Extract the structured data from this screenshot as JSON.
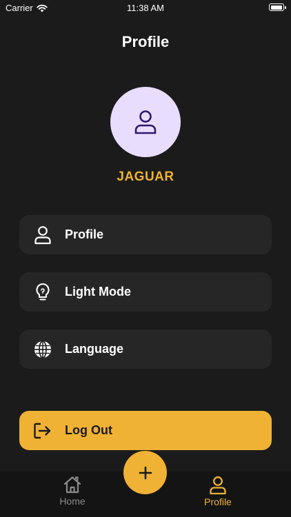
{
  "status_bar": {
    "carrier": "Carrier",
    "time": "11:38 AM"
  },
  "header": {
    "title": "Profile"
  },
  "user": {
    "name": "JAGUAR"
  },
  "menu": {
    "items": [
      {
        "label": "Profile",
        "icon": "person-icon"
      },
      {
        "label": "Light Mode",
        "icon": "lightbulb-icon"
      },
      {
        "label": "Language",
        "icon": "globe-icon"
      }
    ],
    "logout": {
      "label": "Log Out",
      "icon": "logout-icon"
    }
  },
  "bottom_nav": {
    "items": [
      {
        "label": "Home",
        "icon": "home-icon",
        "active": false
      },
      {
        "label": "Profile",
        "icon": "person-icon",
        "active": true
      }
    ],
    "fab_icon": "plus-icon"
  },
  "colors": {
    "background": "#1b1b1b",
    "card": "#262626",
    "accent": "#efb234",
    "avatar_bg": "#e9ddfe",
    "avatar_icon": "#2a1a6b"
  }
}
